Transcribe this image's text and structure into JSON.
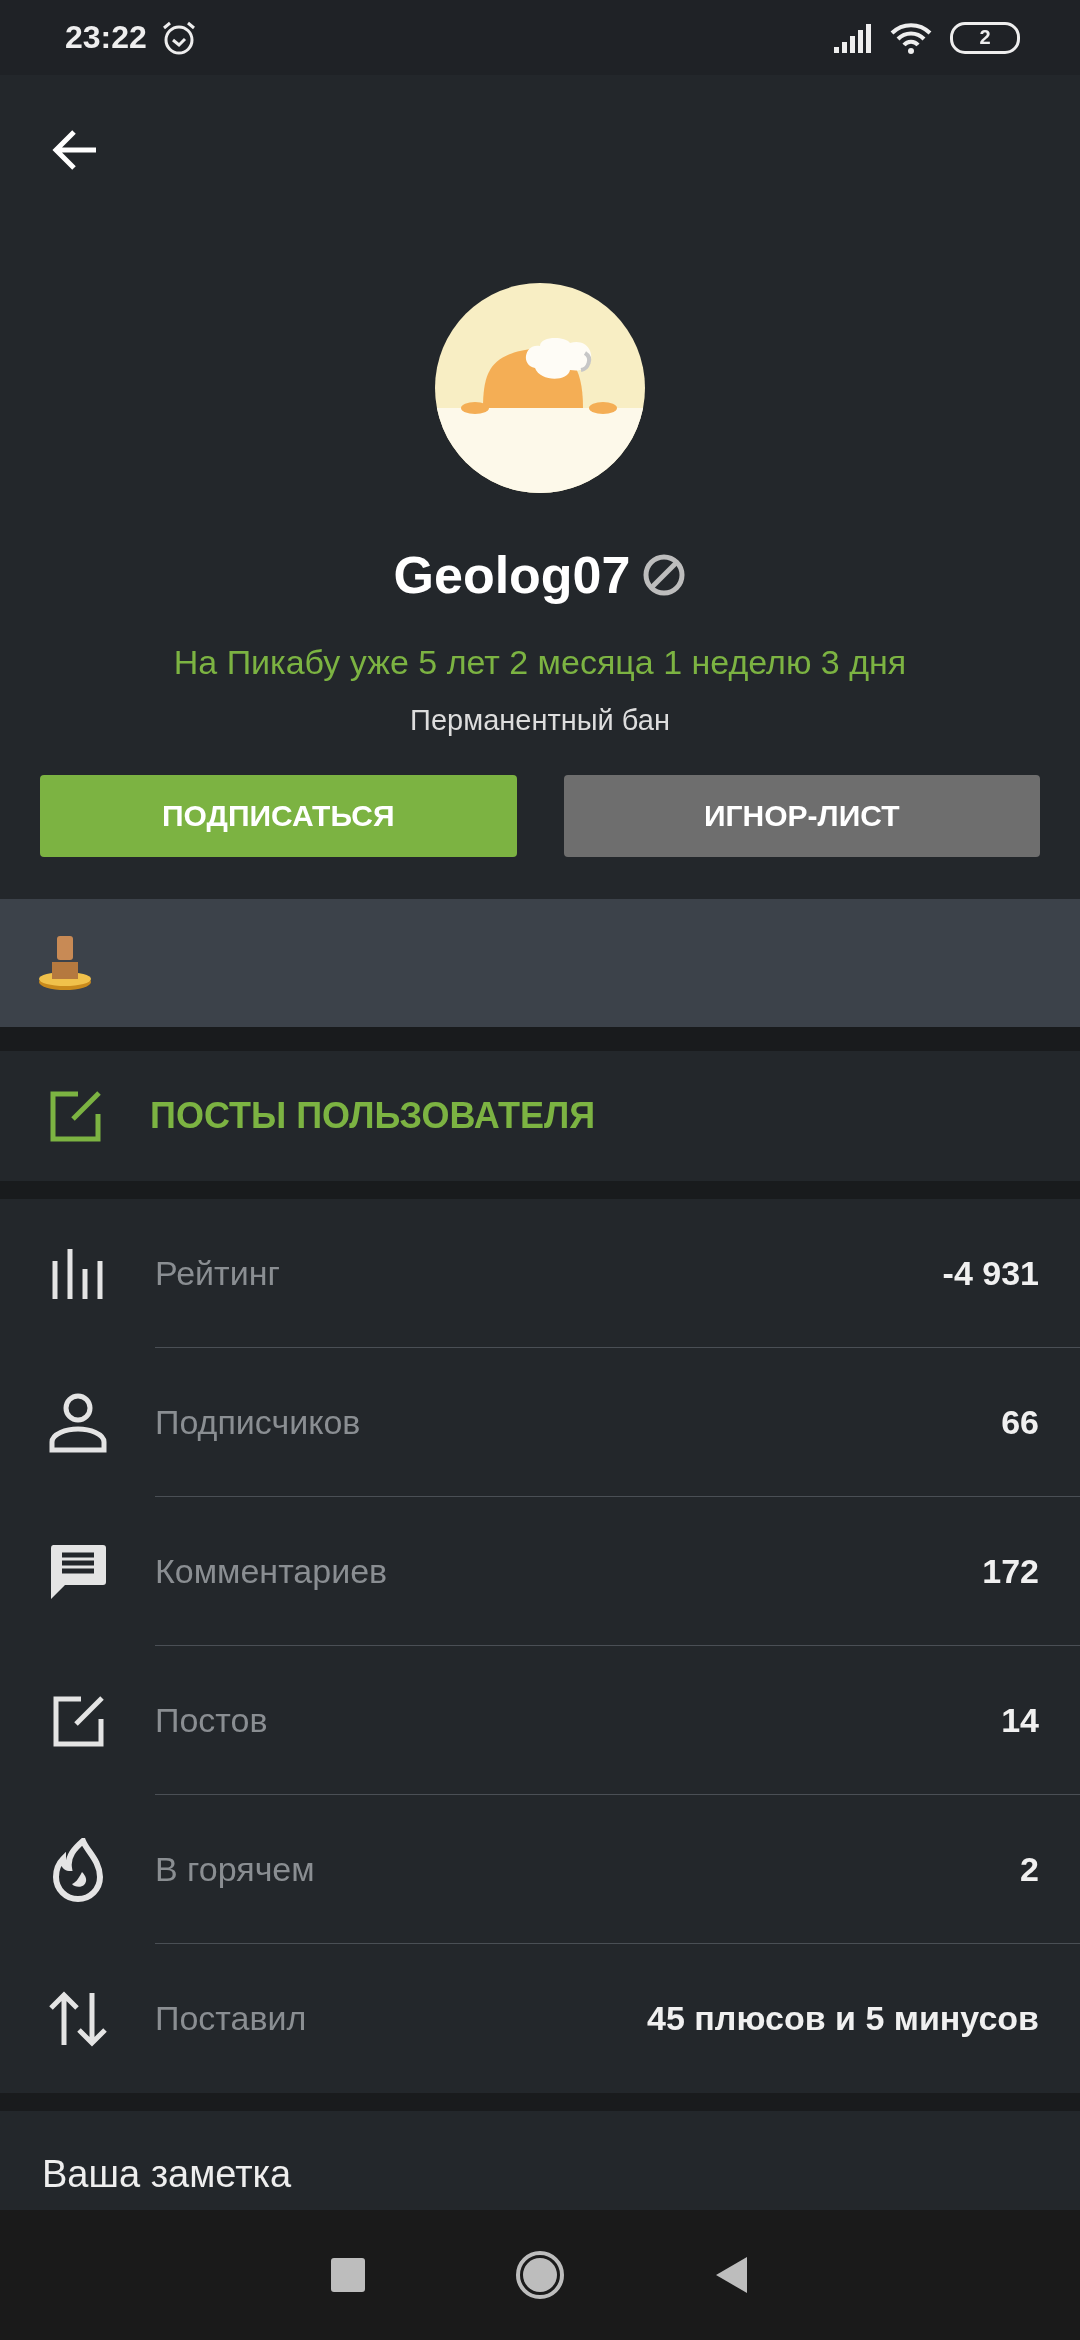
{
  "status_bar": {
    "time": "23:22",
    "battery": "2"
  },
  "profile": {
    "username": "Geolog07",
    "banned": true,
    "tenure": "На Пикабу уже 5 лет 2 месяца 1 неделю 3 дня",
    "status": "Перманентный бан"
  },
  "buttons": [
    {
      "label": "ПОДПИСАТЬСЯ",
      "kind": "primary"
    },
    {
      "label": "ИГНОР-ЛИСТ",
      "kind": "secondary"
    }
  ],
  "awards": [
    {
      "kind": "years"
    }
  ],
  "posts_link": {
    "label": "ПОСТЫ ПОЛЬЗОВАТЕЛЯ"
  },
  "stats": [
    {
      "kind": "rating",
      "label": "Рейтинг",
      "value": "-4 931"
    },
    {
      "kind": "subscribers",
      "label": "Подписчиков",
      "value": "66"
    },
    {
      "kind": "comments",
      "label": "Комментариев",
      "value": "172"
    },
    {
      "kind": "posts",
      "label": "Постов",
      "value": "14"
    },
    {
      "kind": "hot",
      "label": "В горячем",
      "value": "2"
    },
    {
      "kind": "votes",
      "label": "Поставил",
      "value": "45 плюсов и 5 минусов"
    }
  ],
  "note": {
    "title": "Ваша заметка"
  }
}
